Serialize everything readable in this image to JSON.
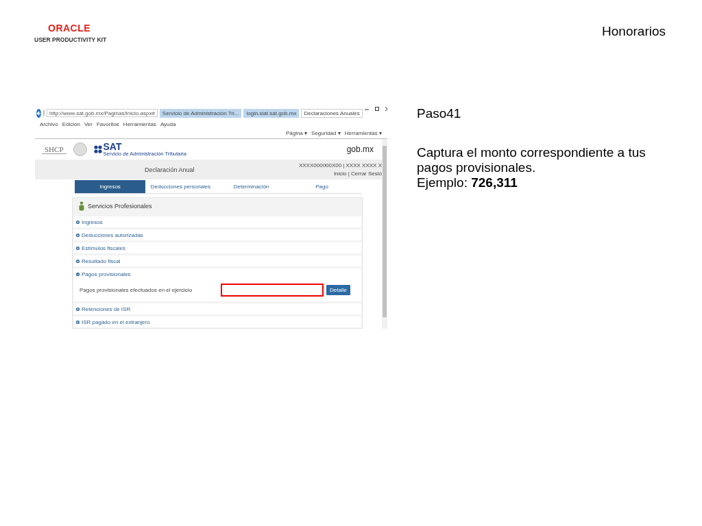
{
  "header": {
    "logo_text": "ORACLE",
    "logo_subtitle": "USER PRODUCTIVITY KIT",
    "title": "Honorarios"
  },
  "browser": {
    "address": "http://www.sat.gob.mx/Paginas/Inicio.aspx#",
    "tabs": [
      {
        "label": "Servicio de Administración Tri...",
        "selected": false
      },
      {
        "label": "login.siat.sat.gob.mx",
        "selected": false
      },
      {
        "label": "Declaraciones Anuales",
        "selected": true
      }
    ],
    "menu": [
      "Archivo",
      "Edición",
      "Ver",
      "Favoritos",
      "Herramientas",
      "Ayuda"
    ],
    "commands": [
      "Página ▾",
      "Seguridad ▾",
      "Herramientas ▾"
    ]
  },
  "site": {
    "shcp": "SHCP",
    "sat": "SAT",
    "sat_subtitle": "Servicio de Administración Tributaria",
    "gov": "gob.mx",
    "page_title": "Declaración Anual",
    "user_id": "XXXX000000X00",
    "user_name": "| XXXX XXXX X",
    "user_links": "Inicio | Cerrar Sesió"
  },
  "steps": [
    {
      "label": "Ingresos",
      "selected": true
    },
    {
      "label": "Deducciones personales",
      "selected": false
    },
    {
      "label": "Determinación",
      "selected": false
    },
    {
      "label": "Pago",
      "selected": false
    }
  ],
  "section": {
    "title": "Servicios Profesionales",
    "items": [
      {
        "label": "Ingresos",
        "expanded": false
      },
      {
        "label": "Deducciones autorizadas",
        "expanded": false
      },
      {
        "label": "Estímulos fiscales",
        "expanded": false
      },
      {
        "label": "Resultado fiscal",
        "expanded": false
      },
      {
        "label": "Pagos provisionales",
        "expanded": true,
        "field": {
          "label": "Pagos provisionales efectuados en el ejercicio",
          "highlighted": true,
          "button": "Detalle"
        }
      },
      {
        "label": "Retenciones de ISR",
        "expanded": false
      },
      {
        "label": "ISR pagado en el extranjero",
        "expanded": false
      }
    ]
  },
  "instructions": {
    "step": "Paso41",
    "lines": [
      "Captura el monto correspondiente a tus pagos provisionales.",
      "Ejemplo: **726,311**"
    ]
  }
}
